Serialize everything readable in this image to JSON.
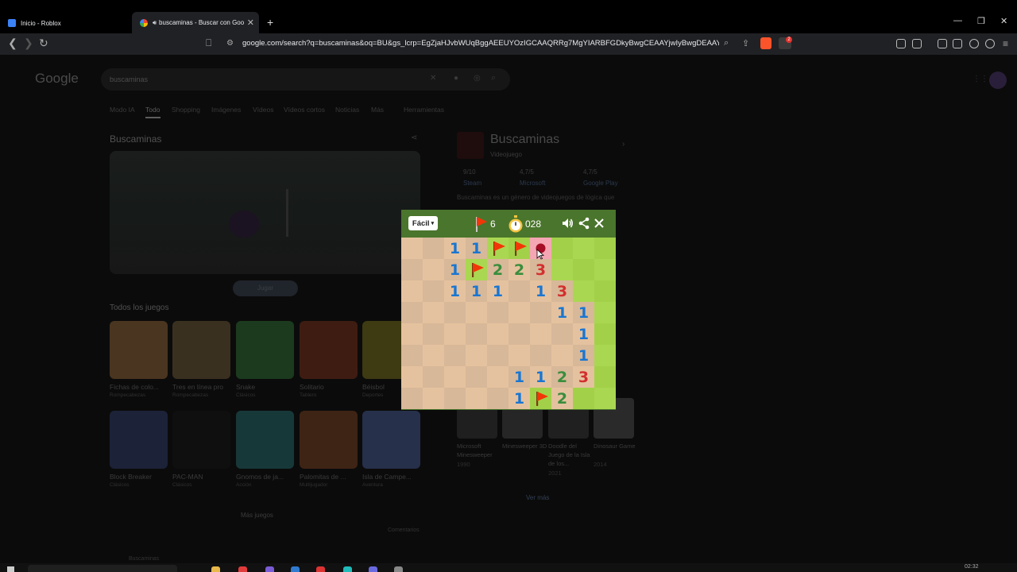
{
  "browser": {
    "tabs": [
      {
        "title": "Inicio - Roblox",
        "active": false,
        "color": "#3b82f6"
      },
      {
        "title": "buscaminas - Buscar con Goo",
        "active": true,
        "color": "#ea4335"
      }
    ],
    "url": "google.com/search?q=buscaminas&oq=BU&gs_lcrp=EgZjaHJvbWUqBggAEEUYOzIGCAAQRRg7MgYIARBFGDkyBwgCEAAYjwIyBwgDEAAYjwIyB...",
    "ext_badge": "2"
  },
  "google": {
    "logo": "Google",
    "query": "buscaminas",
    "tabs": [
      "Modo IA",
      "Todo",
      "Shopping",
      "Imágenes",
      "Vídeos",
      "Vídeos cortos",
      "Noticias",
      "Más",
      "Herramientas"
    ],
    "section_title": "Buscaminas",
    "play_label": "Jugar",
    "all_games_title": "Todos los juegos",
    "games": [
      {
        "title": "Fichas de colo...",
        "sub": "Rompecabezas",
        "color": "#7a4a24"
      },
      {
        "title": "Tres en línea pro",
        "sub": "Rompecabezas",
        "color": "#5c4a32"
      },
      {
        "title": "Snake",
        "sub": "Clásicos",
        "color": "#1f4a26"
      },
      {
        "title": "Solitario",
        "sub": "Tablero",
        "color": "#5a2418"
      },
      {
        "title": "Béisbol",
        "sub": "Deportes",
        "color": "#5a5314"
      },
      {
        "title": "Block Breaker",
        "sub": "Clásicos",
        "color": "#242c4a"
      },
      {
        "title": "PAC-MAN",
        "sub": "Clásicos",
        "color": "#141414"
      },
      {
        "title": "Gnomos de ja...",
        "sub": "Acción",
        "color": "#1e4a4a"
      },
      {
        "title": "Palomitas de ...",
        "sub": "Multijugador",
        "color": "#5a3018"
      },
      {
        "title": "Isla de Campe...",
        "sub": "Aventura",
        "color": "#34405a"
      }
    ],
    "more_games": "Más juegos",
    "kp": {
      "title": "Buscaminas",
      "subtitle": "Videojuego",
      "ratings": [
        {
          "value": "9/10",
          "source": "Steam"
        },
        {
          "value": "4,7/5",
          "source": "Microsoft"
        },
        {
          "value": "4,7/5",
          "source": "Google Play"
        }
      ],
      "description": "Buscaminas es un género de videojuegos de lógica que",
      "related": [
        {
          "caption": "Microsoft Minesweeper",
          "year": "1990"
        },
        {
          "caption": "Minesweeper 3D",
          "year": ""
        },
        {
          "caption": "Doodle del Juego de la Isla de los...",
          "year": "2021"
        },
        {
          "caption": "Dinosaur Game",
          "year": "2014"
        }
      ],
      "see_more": "Ver más"
    },
    "feedback": "Comentarios",
    "bottom": "Buscaminas"
  },
  "minesweeper": {
    "difficulty": "Fácil",
    "flags_left": "6",
    "timer": "028",
    "colors": {
      "n1": "#1976d2",
      "n2": "#388e3c",
      "n3": "#d32f2f",
      "flag": "#f23607",
      "g_light": "#aad751",
      "g_dark": "#a2d149",
      "r_light": "#e5c29f",
      "r_dark": "#d7b899",
      "header": "#4a752c"
    },
    "board": [
      [
        "r",
        "r",
        "1",
        "1",
        "F",
        "F",
        "X",
        "g",
        "g",
        "g"
      ],
      [
        "r",
        "r",
        "1",
        "F",
        "2",
        "2",
        "3",
        "g",
        "g",
        "g"
      ],
      [
        "r",
        "r",
        "1",
        "1",
        "1",
        "r",
        "1",
        "3",
        "g",
        "g"
      ],
      [
        "r",
        "r",
        "r",
        "r",
        "r",
        "r",
        "r",
        "1",
        "1",
        "g"
      ],
      [
        "r",
        "r",
        "r",
        "r",
        "r",
        "r",
        "r",
        "r",
        "1",
        "g"
      ],
      [
        "r",
        "r",
        "r",
        "r",
        "r",
        "r",
        "r",
        "r",
        "1",
        "g"
      ],
      [
        "r",
        "r",
        "r",
        "r",
        "r",
        "1",
        "1",
        "2",
        "3",
        "g"
      ],
      [
        "r",
        "r",
        "r",
        "r",
        "r",
        "1",
        "F",
        "2",
        "g",
        "g"
      ]
    ]
  },
  "taskbar": {
    "time": "02:32"
  }
}
